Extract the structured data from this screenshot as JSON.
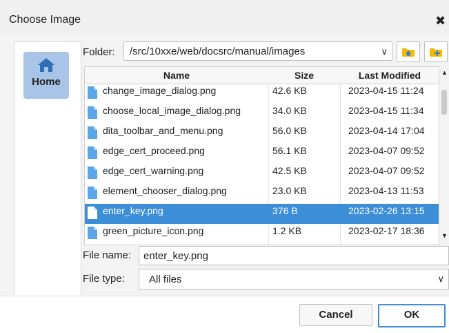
{
  "dialog": {
    "title": "Choose Image",
    "close_glyph": "✖"
  },
  "sidebar": {
    "home_label": "Home",
    "home_icon": "home-icon"
  },
  "folder": {
    "label": "Folder:",
    "path": "/src/10xxe/web/docsrc/manual/images"
  },
  "table": {
    "headers": {
      "name": "Name",
      "size": "Size",
      "modified": "Last Modified"
    },
    "rows": [
      {
        "name": "change_image_dialog.png",
        "size": "42.6 KB",
        "modified": "2023-04-15 11:24",
        "selected": false
      },
      {
        "name": "choose_local_image_dialog.png",
        "size": "34.0 KB",
        "modified": "2023-04-15 11:34",
        "selected": false
      },
      {
        "name": "dita_toolbar_and_menu.png",
        "size": "56.0 KB",
        "modified": "2023-04-14 17:04",
        "selected": false
      },
      {
        "name": "edge_cert_proceed.png",
        "size": "56.1 KB",
        "modified": "2023-04-07 09:52",
        "selected": false
      },
      {
        "name": "edge_cert_warning.png",
        "size": "42.5 KB",
        "modified": "2023-04-07 09:52",
        "selected": false
      },
      {
        "name": "element_chooser_dialog.png",
        "size": "23.0 KB",
        "modified": "2023-04-13 11:53",
        "selected": false
      },
      {
        "name": "enter_key.png",
        "size": "376 B",
        "modified": "2023-02-26 13:15",
        "selected": true
      },
      {
        "name": "green_picture_icon.png",
        "size": "1.2 KB",
        "modified": "2023-02-17 18:36",
        "selected": false
      }
    ]
  },
  "file_name": {
    "label": "File name:",
    "value": "enter_key.png"
  },
  "file_type": {
    "label": "File type:",
    "value": "All files"
  },
  "buttons": {
    "cancel": "Cancel",
    "ok": "OK"
  },
  "colors": {
    "selection": "#3d8ed8",
    "home_bg": "#a8c4e6",
    "folder_icon": "#f5b800",
    "up_arrow": "#2b7fd6",
    "file_icon": "#5aa6e6"
  }
}
